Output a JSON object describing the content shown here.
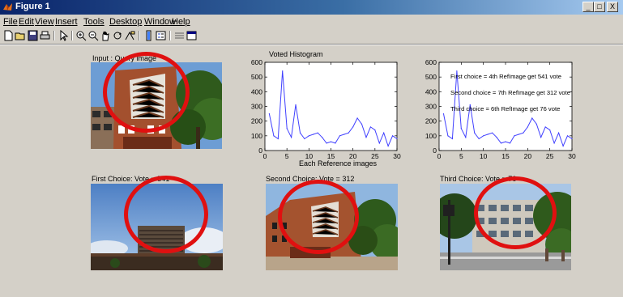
{
  "window": {
    "title": "Figure 1",
    "controls": {
      "minimize": "_",
      "maximize": "□",
      "close": "X"
    }
  },
  "menubar": [
    "File",
    "Edit",
    "View",
    "Insert",
    "Tools",
    "Desktop",
    "Window",
    "Help"
  ],
  "toolbar": [
    "new-icon",
    "open-icon",
    "save-icon",
    "print-icon",
    "pointer-icon",
    "zoom-in-icon",
    "zoom-out-icon",
    "pan-icon",
    "rotate-icon",
    "data-cursor-icon",
    "insert-colorbar-icon",
    "insert-legend-icon",
    "hide-plot-tools-icon",
    "show-plot-tools-icon"
  ],
  "panels": {
    "query": {
      "title": "Input : Query image"
    },
    "first": {
      "title": "First Choice: Vote = 541"
    },
    "second": {
      "title": "Second Choice: Vote = 312"
    },
    "third": {
      "title": "Third Choice: Vote = 76"
    }
  },
  "highlight_color": "#e01010",
  "chart_data": [
    {
      "type": "line",
      "title": "Voted Histogram",
      "xlabel": "Each Reference images",
      "ylabel": "",
      "xlim": [
        0,
        30
      ],
      "ylim": [
        0,
        600
      ],
      "xticks": [
        0,
        5,
        10,
        15,
        20,
        25,
        30
      ],
      "yticks": [
        0,
        100,
        200,
        300,
        400,
        500,
        600
      ],
      "line_color": "#4040ff",
      "x": [
        1,
        2,
        3,
        4,
        5,
        6,
        7,
        8,
        9,
        10,
        11,
        12,
        13,
        14,
        15,
        16,
        17,
        18,
        19,
        20,
        21,
        22,
        23,
        24,
        25,
        26,
        27,
        28,
        29,
        30
      ],
      "values": [
        250,
        100,
        80,
        541,
        150,
        90,
        312,
        120,
        80,
        100,
        110,
        120,
        90,
        50,
        60,
        50,
        100,
        110,
        120,
        160,
        220,
        180,
        90,
        160,
        140,
        50,
        120,
        30,
        100,
        80
      ],
      "annotations": []
    },
    {
      "type": "line",
      "title": "",
      "xlabel": "",
      "ylabel": "",
      "xlim": [
        0,
        30
      ],
      "ylim": [
        0,
        600
      ],
      "xticks": [
        0,
        5,
        10,
        15,
        20,
        25,
        30
      ],
      "yticks": [
        0,
        100,
        200,
        300,
        400,
        500,
        600
      ],
      "line_color": "#4040ff",
      "x": [
        1,
        2,
        3,
        4,
        5,
        6,
        7,
        8,
        9,
        10,
        11,
        12,
        13,
        14,
        15,
        16,
        17,
        18,
        19,
        20,
        21,
        22,
        23,
        24,
        25,
        26,
        27,
        28,
        29,
        30
      ],
      "values": [
        250,
        100,
        80,
        541,
        150,
        90,
        312,
        120,
        80,
        100,
        110,
        120,
        90,
        50,
        60,
        50,
        100,
        110,
        120,
        160,
        220,
        180,
        90,
        160,
        140,
        50,
        120,
        30,
        100,
        80
      ],
      "annotations": [
        "First choice = 4th RefImage get 541 vote",
        "Second choice = 7th RefImage get 312 vote",
        "Third choice = 6th RefImage get 76 vote"
      ]
    }
  ]
}
